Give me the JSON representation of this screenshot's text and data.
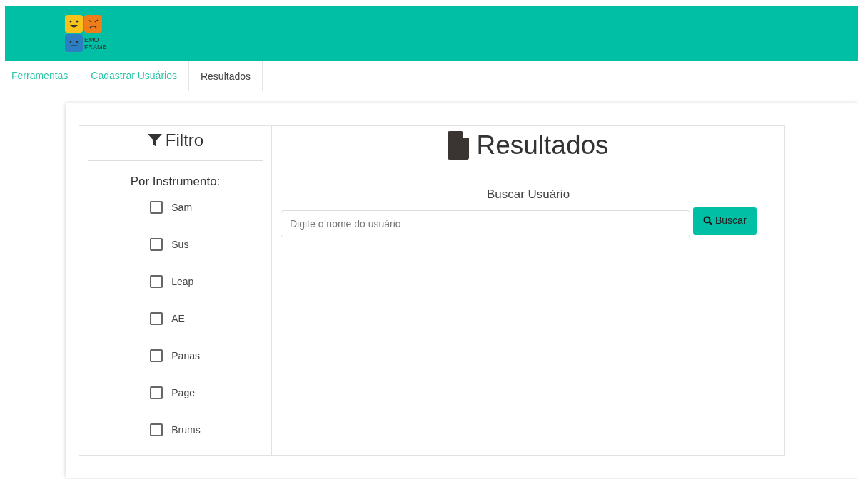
{
  "header": {
    "logo_text": [
      "EMO",
      "FRAME"
    ]
  },
  "tabs": [
    {
      "label": "Ferramentas",
      "selected": false
    },
    {
      "label": "Cadastrar Usuários",
      "selected": false
    },
    {
      "label": "Resultados",
      "selected": true
    }
  ],
  "filter": {
    "title": "Filtro",
    "subtitle": "Por Instrumento:",
    "options": [
      {
        "label": "Sam",
        "checked": false
      },
      {
        "label": "Sus",
        "checked": false
      },
      {
        "label": "Leap",
        "checked": false
      },
      {
        "label": "AE",
        "checked": false
      },
      {
        "label": "Panas",
        "checked": false
      },
      {
        "label": "Page",
        "checked": false
      },
      {
        "label": "Brums",
        "checked": false
      }
    ]
  },
  "results": {
    "title": "Resultados",
    "search_label": "Buscar Usuário",
    "search": {
      "placeholder": "Digite o nome do usuário"
    },
    "search_button": "Buscar"
  }
}
